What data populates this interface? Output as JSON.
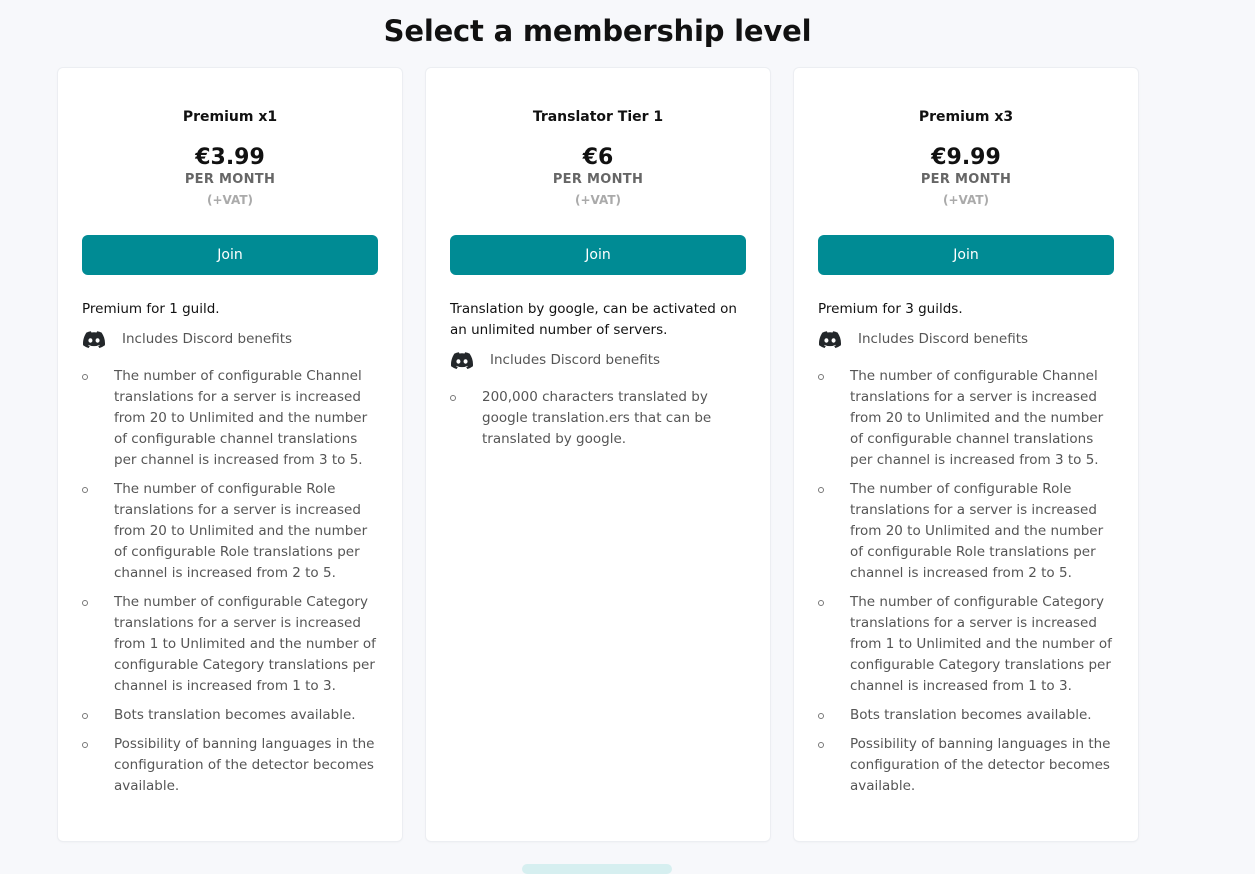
{
  "page": {
    "title": "Select a membership level"
  },
  "tiers": [
    {
      "name": "Premium x1",
      "price": "€3.99",
      "period": "PER MONTH",
      "vat": "(+VAT)",
      "button": "Join",
      "description": "Premium for 1 guild.",
      "benefits_label": "Includes Discord benefits",
      "features": [
        "The number of configurable Channel translations for a server is increased from 20 to Unlimited and the number of configurable channel translations per channel is increased from 3 to 5.",
        "The number of configurable Role translations for a server is increased from 20 to Unlimited and the number of configurable Role translations per channel is increased from 2 to 5.",
        "The number of configurable Category translations for a server is increased from 1 to Unlimited and the number of configurable Category translations per channel is increased from 1 to 3.",
        "Bots translation becomes available.",
        "Possibility of banning languages in the configuration of the detector becomes available."
      ]
    },
    {
      "name": "Translator Tier 1",
      "price": "€6",
      "period": "PER MONTH",
      "vat": "(+VAT)",
      "button": "Join",
      "description": "Translation by google, can be activated on an unlimited number of servers.",
      "benefits_label": "Includes Discord benefits",
      "features": [
        "200,000 characters translated by google translation.ers that can be translated by google."
      ]
    },
    {
      "name": "Premium x3",
      "price": "€9.99",
      "period": "PER MONTH",
      "vat": "(+VAT)",
      "button": "Join",
      "description": "Premium for 3 guilds.",
      "benefits_label": "Includes Discord benefits",
      "features": [
        "The number of configurable Channel translations for a server is increased from 20 to Unlimited and the number of configurable channel translations per channel is increased from 3 to 5.",
        "The number of configurable Role translations for a server is increased from 20 to Unlimited and the number of configurable Role translations per channel is increased from 2 to 5.",
        "The number of configurable Category translations for a server is increased from 1 to Unlimited and the number of configurable Category translations per channel is increased from 1 to 3.",
        "Bots translation becomes available.",
        "Possibility of banning languages in the configuration of the detector becomes available."
      ]
    }
  ],
  "colors": {
    "accent": "#008b94",
    "background": "#f7f8fb",
    "card": "#ffffff"
  },
  "icons": {
    "benefits": "discord-icon",
    "list_bullet": "circle-bullet"
  }
}
